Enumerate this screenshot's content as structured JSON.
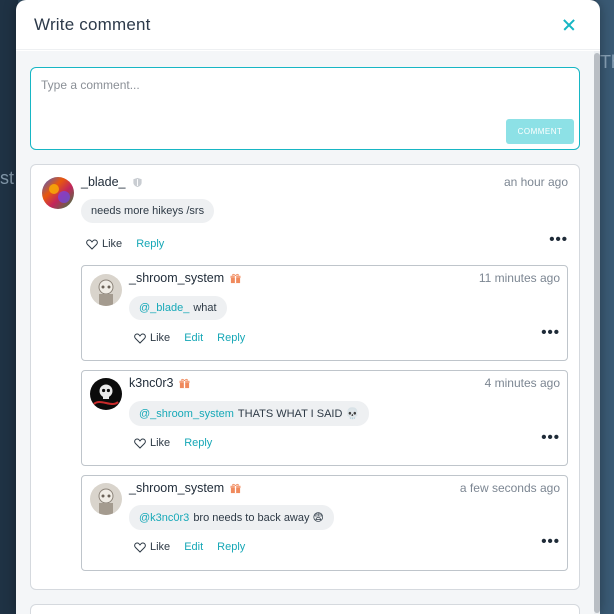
{
  "modal": {
    "title": "Write comment"
  },
  "compose": {
    "placeholder": "Type a comment...",
    "button_label": "COMMENT"
  },
  "background": {
    "frag_top": "Th",
    "frag_left": "st"
  },
  "thread": {
    "comment": {
      "author": "_blade_",
      "time": "an hour ago",
      "text": "needs more hikeys /srs",
      "actions": {
        "like": "Like",
        "reply": "Reply"
      }
    },
    "replies": [
      {
        "author": "_shroom_system",
        "time": "11 minutes ago",
        "mention": "@_blade_",
        "text": "what",
        "actions": {
          "like": "Like",
          "edit": "Edit",
          "reply": "Reply"
        }
      },
      {
        "author": "k3nc0r3",
        "time": "4 minutes ago",
        "mention": "@_shroom_system",
        "text": "THATS WHAT I SAID 💀",
        "actions": {
          "like": "Like",
          "reply": "Reply"
        }
      },
      {
        "author": "_shroom_system",
        "time": "a few seconds ago",
        "mention": "@k3nc0r3",
        "text": "bro needs to back away 😨",
        "actions": {
          "like": "Like",
          "edit": "Edit",
          "reply": "Reply"
        }
      }
    ]
  },
  "colors": {
    "accent": "#16b6c4",
    "button_disabled": "#8de1e6",
    "badge": "#f08a5d"
  }
}
